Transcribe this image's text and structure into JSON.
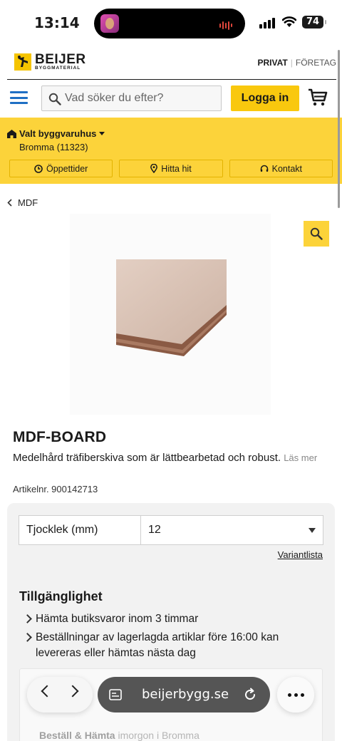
{
  "status_bar": {
    "time": "13:14",
    "battery": "74"
  },
  "header": {
    "brand_name": "BEIJER",
    "brand_sub": "BYGGMATERIAL",
    "segment_active": "PRIVAT",
    "segment_other": "FÖRETAG",
    "search_placeholder": "Vad söker du efter?",
    "login_label": "Logga in"
  },
  "store": {
    "title": "Valt byggvaruhus",
    "name": "Bromma (11323)",
    "buttons": [
      "Öppettider",
      "Hitta hit",
      "Kontakt"
    ]
  },
  "breadcrumb": {
    "label": "MDF"
  },
  "product": {
    "title": "MDF-BOARD",
    "description": "Medelhård träfiberskiva som är lättbearbetad och robust.",
    "read_more": "Läs mer",
    "article_number": "Artikelnr. 900142713"
  },
  "variant": {
    "label": "Tjocklek (mm)",
    "value": "12",
    "list_link": "Variantlista"
  },
  "availability": {
    "heading": "Tillgänglighet",
    "items": [
      "Hämta butiksvaror inom 3 timmar",
      "Beställningar av lagerlagda artiklar före 16:00 kan levereras eller hämtas nästa dag"
    ],
    "pickup_bold": "Beställ & Hämta",
    "pickup_rest": "imorgon i Bromma"
  },
  "browser": {
    "url": "beijerbygg.se"
  },
  "colors": {
    "brand_yellow": "#fcd33a",
    "accent_blue": "#1f6fc4",
    "text": "#1a1a1a"
  }
}
